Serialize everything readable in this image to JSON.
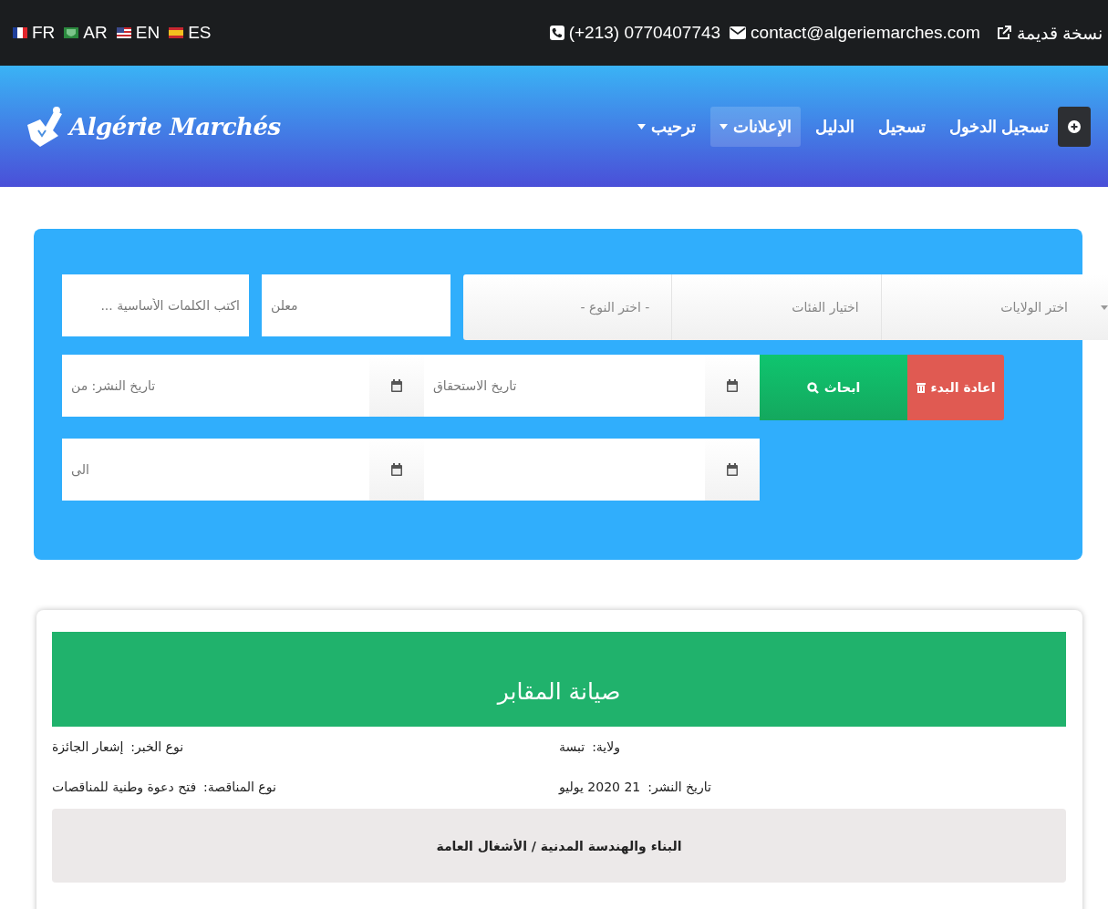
{
  "top_bar": {
    "languages": [
      {
        "code": "ES"
      },
      {
        "code": "EN"
      },
      {
        "code": "AR"
      },
      {
        "code": "FR"
      }
    ],
    "phone": "(+213) 0770407743",
    "email": "contact@algeriemarches.com",
    "old_version": "نسخة قديمة"
  },
  "nav": {
    "logo": "Algérie Marchés",
    "items": [
      {
        "label": "تسجيل الدخول",
        "dropdown": false,
        "selected": false
      },
      {
        "label": "تسجيل",
        "dropdown": false,
        "selected": false
      },
      {
        "label": "الدليل",
        "dropdown": false,
        "selected": false
      },
      {
        "label": "الإعلانات",
        "dropdown": true,
        "selected": true
      },
      {
        "label": "ترحيب",
        "dropdown": true,
        "selected": false
      }
    ]
  },
  "search": {
    "keyword": {
      "placeholder": "اكتب الكلمات الأساسية ..."
    },
    "advertiser": {
      "placeholder": "معلن"
    },
    "selects": [
      {
        "placeholder": "اختر الولايات"
      },
      {
        "placeholder": "اختيار الفئات"
      },
      {
        "placeholder": "- اختر النوع -"
      }
    ],
    "publish_from": {
      "placeholder": "تاريخ النشر: من"
    },
    "due_date": {
      "placeholder": "تاريخ الاستحقاق"
    },
    "publish_to": {
      "placeholder": "الى"
    },
    "search_button": "ابحاث",
    "reset_button": "اعادة البدء"
  },
  "card": {
    "title": "صيانة المقابر",
    "details": [
      {
        "label": "ولاية:",
        "value": "تبسة"
      },
      {
        "label": "نوع الخبر:",
        "value": "إشعار الجائزة"
      },
      {
        "label": "تاريخ النشر:",
        "value": "21 2020 يوليو"
      },
      {
        "label": "نوع المناقصة:",
        "value": "فتح دعوة وطنية للمناقصات"
      }
    ],
    "category": "البناء والهندسة المدنية / الأشغال العامة"
  }
}
